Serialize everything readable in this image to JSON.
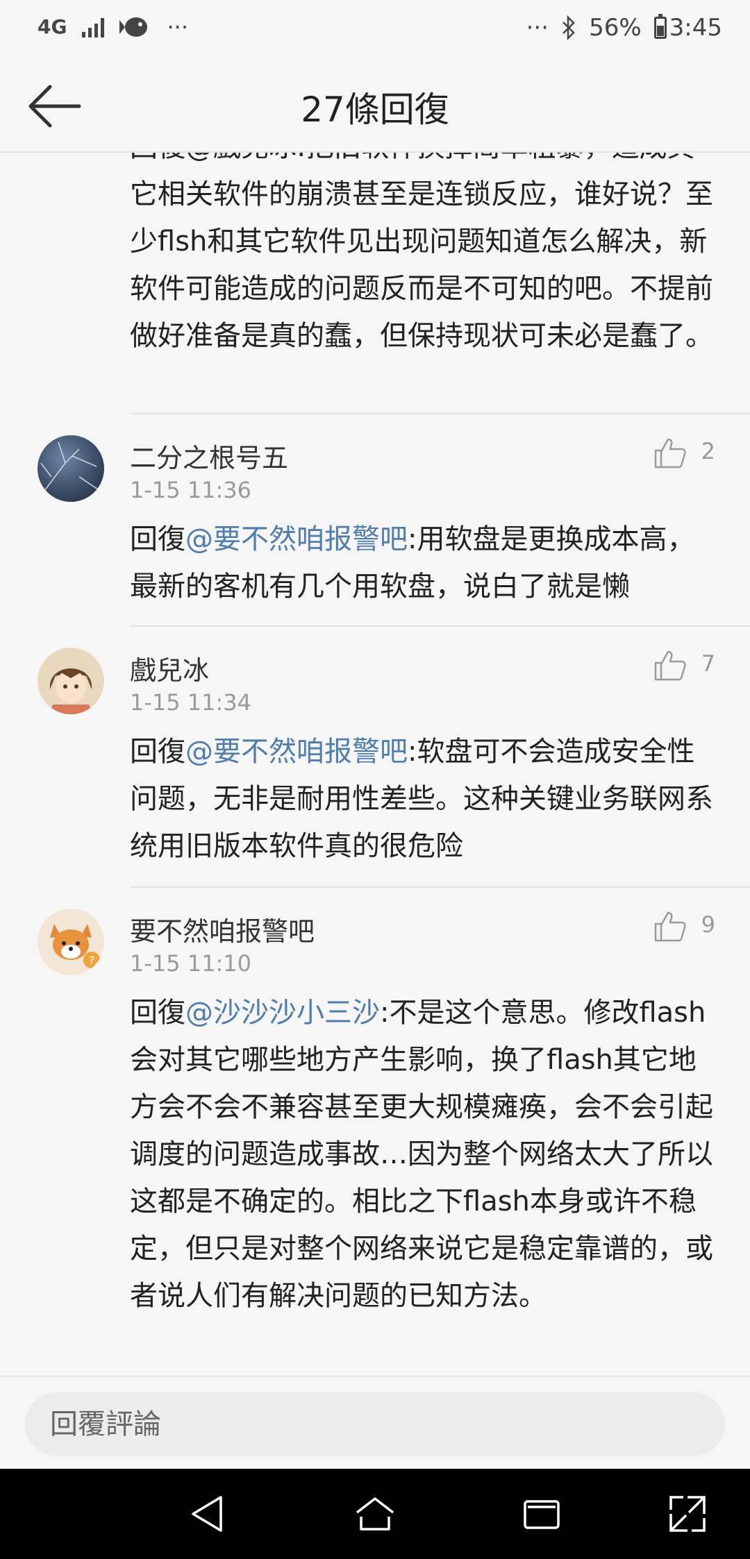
{
  "status_bar": {
    "network": "4G",
    "dots_left": "···",
    "dots_right": "···",
    "battery": "56%",
    "time": "3:45"
  },
  "header": {
    "title": "27條回復"
  },
  "previous_comment": {
    "text": "回復@戲兒冰:把旧软件换掉简单粗暴，造成其它相关软件的崩溃甚至是连锁反应，谁好说？至少flsh和其它软件见出现问题知道怎么解决，新软件可能造成的问题反而是不可知的吧。不提前做好准备是真的蠢，但保持现状可未必是蠢了。"
  },
  "comments": [
    {
      "name": "二分之根号五",
      "time": "1-15 11:36",
      "likes": "2",
      "reply_prefix": "回復",
      "mention": "@要不然咱报警吧",
      "text": ":用软盘是更换成本高，最新的客机有几个用软盘，说白了就是懒"
    },
    {
      "name": "戲兒冰",
      "time": "1-15 11:34",
      "likes": "7",
      "reply_prefix": "回復",
      "mention": "@要不然咱报警吧",
      "text": ":软盘可不会造成安全性问题，无非是耐用性差些。这种关键业务联网系统用旧版本软件真的很危险"
    },
    {
      "name": "要不然咱报警吧",
      "time": "1-15 11:10",
      "likes": "9",
      "reply_prefix": "回復",
      "mention": "@沙沙沙小三沙",
      "text": ":不是这个意思。修改flash会对其它哪些地方产生影响，换了flash其它地方会不会不兼容甚至更大规模瘫痪，会不会引起调度的问题造成事故…因为整个网络太大了所以这都是不确定的。相比之下flash本身或许不稳定，但只是对整个网络来说它是稳定靠谱的，或者说人们有解决问题的已知方法。"
    }
  ],
  "reply_bar": {
    "placeholder": "回覆評論"
  },
  "icons": {
    "back": "arrow-left-icon",
    "like": "thumbs-up-icon",
    "nav_back": "triangle-back-icon",
    "nav_home": "home-icon",
    "nav_recents": "recents-icon",
    "nav_expand": "expand-icon"
  }
}
